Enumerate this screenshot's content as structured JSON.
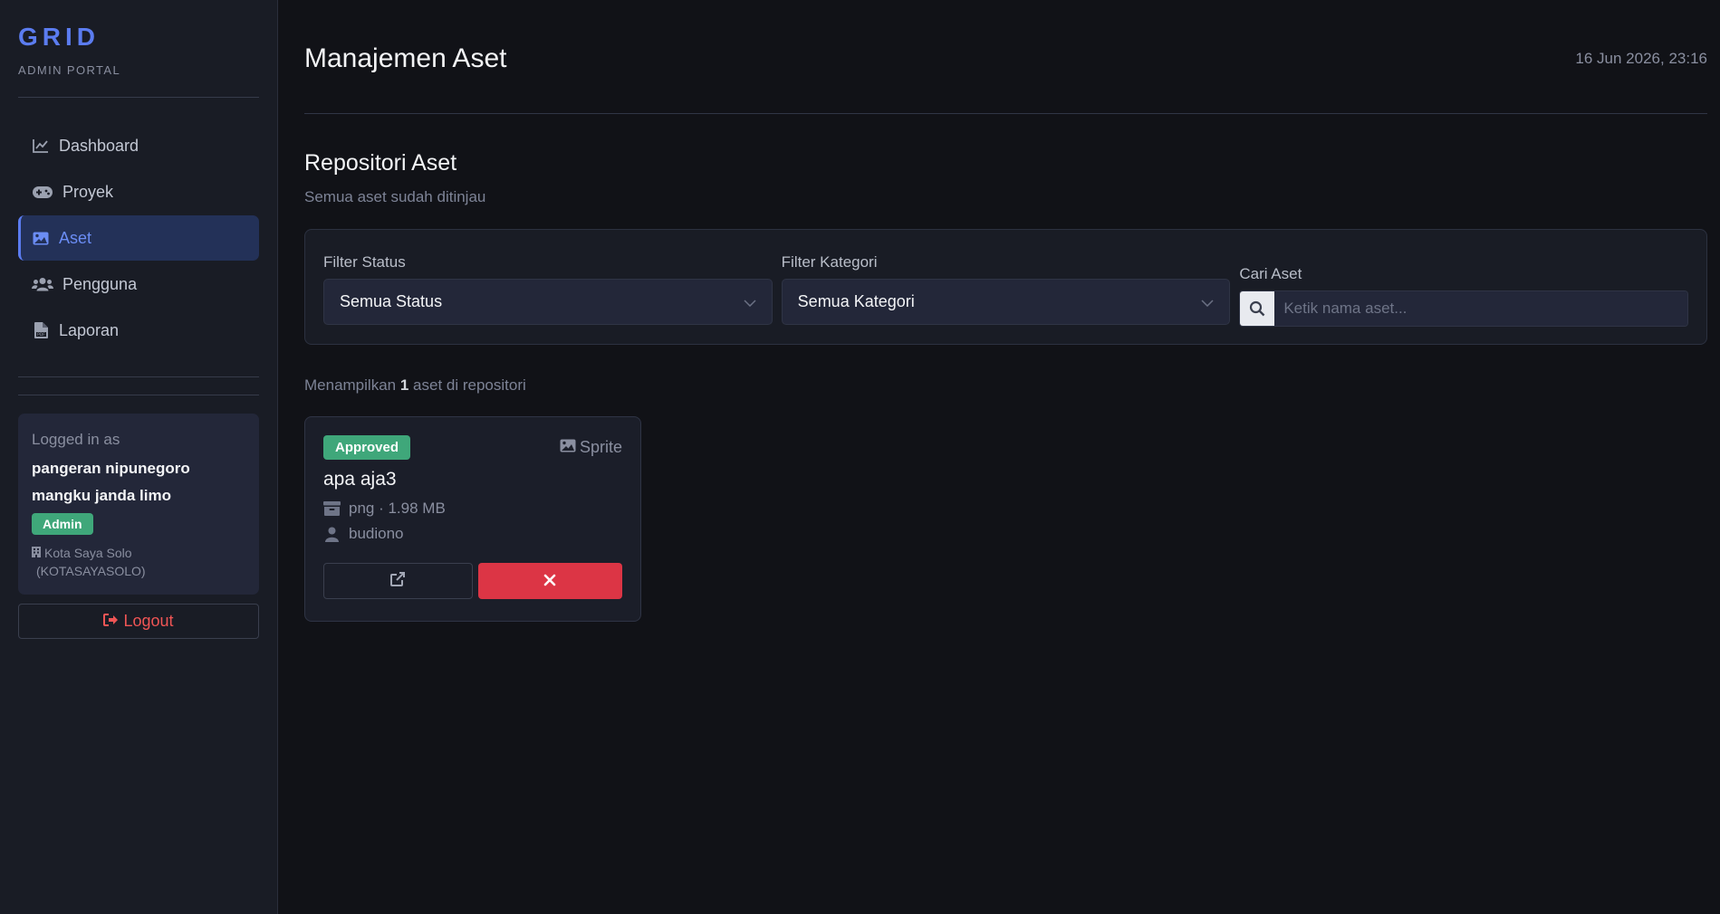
{
  "brand": {
    "name": "GRID",
    "subtitle": "ADMIN PORTAL"
  },
  "sidebar": {
    "items": [
      {
        "label": "Dashboard",
        "icon": "chart-line-icon"
      },
      {
        "label": "Proyek",
        "icon": "gamepad-icon"
      },
      {
        "label": "Aset",
        "icon": "image-icon",
        "active": true
      },
      {
        "label": "Pengguna",
        "icon": "users-icon"
      },
      {
        "label": "Laporan",
        "icon": "file-pdf-icon"
      }
    ],
    "user": {
      "logged_label": "Logged in as",
      "name_line1": "pangeran nipunegoro",
      "name_line2": "mangku janda limo",
      "role": "Admin",
      "org_line1": "Kota Saya Solo",
      "org_line2": "(KOTASAYASOLO)"
    },
    "logout_label": "Logout"
  },
  "header": {
    "title": "Manajemen Aset",
    "datetime": "16 Jun 2026, 23:16"
  },
  "section": {
    "title": "Repositori Aset",
    "subtitle": "Semua aset sudah ditinjau"
  },
  "filters": {
    "status_label": "Filter Status",
    "status_value": "Semua Status",
    "category_label": "Filter Kategori",
    "category_value": "Semua Kategori",
    "search_label": "Cari Aset",
    "search_placeholder": "Ketik nama aset..."
  },
  "results": {
    "prefix": "Menampilkan",
    "count": "1",
    "suffix": "aset di repositori"
  },
  "assets": [
    {
      "status": "Approved",
      "type": "Sprite",
      "name": "apa aja3",
      "file_info": "png · 1.98 MB",
      "owner": "budiono"
    }
  ],
  "colors": {
    "accent": "#5b7cf0",
    "approved": "#3fa77a",
    "danger": "#dc3545",
    "logout": "#ef5555"
  }
}
